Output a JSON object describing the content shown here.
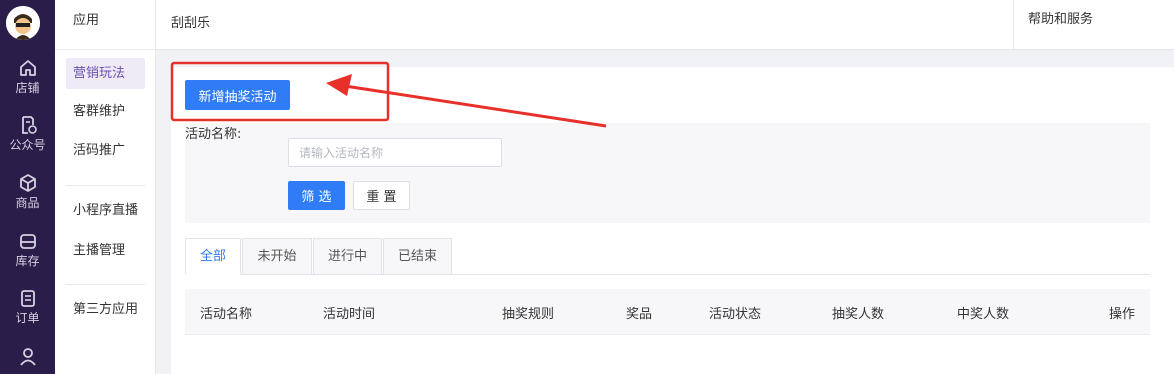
{
  "rail": {
    "items": [
      {
        "label": "店铺",
        "icon": "home-icon"
      },
      {
        "label": "公众号",
        "icon": "document-check-icon"
      },
      {
        "label": "商品",
        "icon": "box-icon"
      },
      {
        "label": "库存",
        "icon": "inbox-icon"
      },
      {
        "label": "订单",
        "icon": "clipboard-icon"
      },
      {
        "label": "",
        "icon": "users-icon"
      }
    ]
  },
  "submenu": {
    "head": "应用",
    "items": [
      "营销玩法",
      "客群维护",
      "活码推广",
      "小程序直播",
      "主播管理",
      "第三方应用"
    ],
    "active": "营销玩法"
  },
  "topbar": {
    "breadcrumb": "刮刮乐",
    "help": "帮助和服务"
  },
  "actions": {
    "add_label": "新增抽奖活动"
  },
  "filter": {
    "name_label": "活动名称:",
    "name_placeholder": "请输入活动名称",
    "name_value": "",
    "filter_label": "筛 选",
    "reset_label": "重 置"
  },
  "tabs": [
    "全部",
    "未开始",
    "进行中",
    "已结束"
  ],
  "active_tab": "全部",
  "table": {
    "columns": [
      "活动名称",
      "活动时间",
      "抽奖规则",
      "奖品",
      "活动状态",
      "抽奖人数",
      "中奖人数",
      "操作"
    ],
    "rows": []
  },
  "colors": {
    "rail_bg": "#2b1d49",
    "accent": "#2f7cf6",
    "menu_active": "#6b4fb0",
    "annotation": "#e8302a"
  }
}
